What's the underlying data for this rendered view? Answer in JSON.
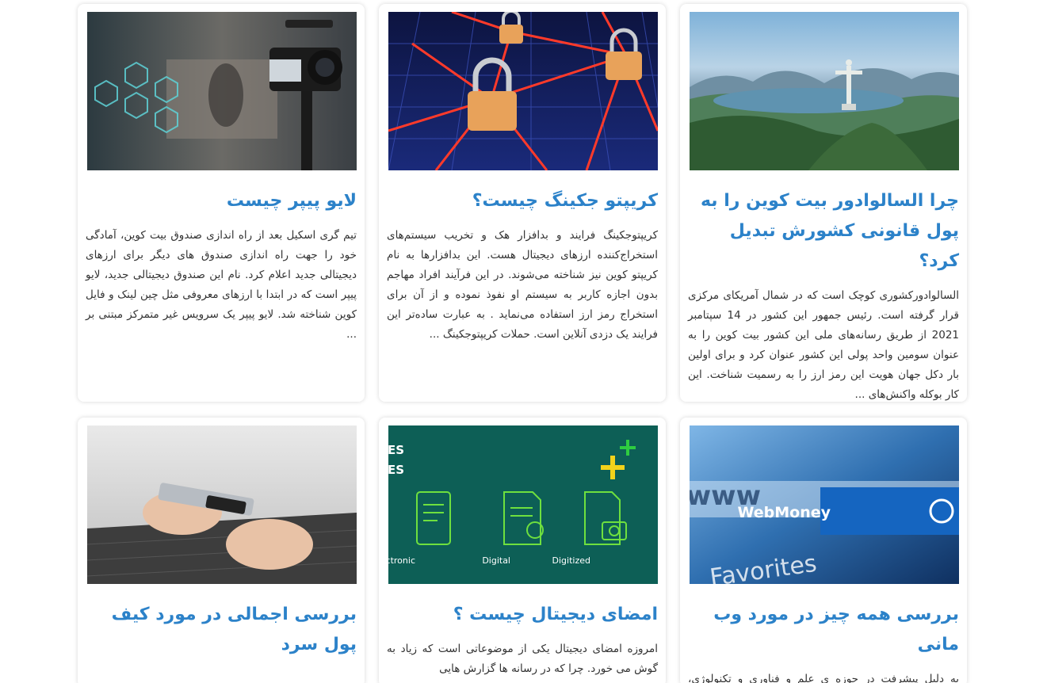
{
  "colors": {
    "title": "#2c82c9",
    "text": "#333333",
    "card_bg": "#ffffff"
  },
  "posts": [
    {
      "title": "چرا السالوادور بیت کوین را به پول قانونی کشورش تبدیل کرد؟",
      "excerpt": "السالوادورکشوری کوچک است که در شمال آمریکای مرکزی قرار گرفته است. رئیس جمهور این کشور در 14 سپتامبر 2021 از طریق رسانه‌های ملی این کشور بیت کوین را به عنوان سومین واحد پولی این کشور عنوان کرد و برای اولین بار دکل جهان هویت این رمز ارز را به رسمیت شناخت. این کار بوکله واکنش‌های ...",
      "image": "rio-christ-redeemer-photo"
    },
    {
      "title": "کریپتو جکینگ چیست؟",
      "excerpt": "کریپتوجکینگ فرایند و بدافزار هک و تخریب سیستم‌های استخراج‌کننده ارزهای دیجیتال هست. این بدافزارها به نام کریپتو کوین نیز شناخته می‌شوند. در این فرآیند افراد مهاجم بدون اجازه کاربر به سیستم او نفوذ نموده و از آن برای استخراج رمز ارز استفاده می‌نماید . به عبارت ساده‌تر این فرایند یک دزدی آنلاین است. حملات کریپتوجکینگ ...",
      "image": "padlock-network-illustration"
    },
    {
      "title": "لایو پیپر چیست",
      "excerpt": "تیم گری اسکیل بعد از راه اندازی صندوق بیت کوین، آمادگی خود را جهت راه اندازی صندوق های دیگر برای ارزهای دیجیتالی جدید اعلام کرد. نام این صندوق دیجیتالی جدید، لایو پیپر است که در ابتدا با ارزهای معروفی مثل چین لینک و فایل کوین شناخته شد. لایو پیپر یک سرویس غیر متمرکز مبتنی بر ...",
      "image": "video-camera-hexagon-icons-photo"
    },
    {
      "title": "بررسی همه چیز در مورد وب مانی",
      "excerpt": "به دلیل پیشرفت در حوزه ی علم و فناوری و تکنولوژی، امروزه اکثر خریدها از طریق اینترنت انجام می شود.",
      "image": "webmoney-browser-photo",
      "image_text": {
        "url": "http://www.",
        "brand": "WebMoney",
        "fav": "Favorites"
      }
    },
    {
      "title": "امضای دیجیتال چیست ؟",
      "excerpt": "امروزه امضای دیجیتال یکی از موضوعاتی است که زیاد به گوش می خورد. چرا که در رسانه ها گزارش هایی",
      "image": "digital-signature-types-infographic",
      "image_text": {
        "heading_line1": "THE DIFFERENCES",
        "heading_line2": "BETWEEN SIGNATURES",
        "labels": [
          "Electronic",
          "Digital",
          "Digitized"
        ]
      }
    },
    {
      "title": "بررسی اجمالی در مورد کیف پول سرد",
      "excerpt": "",
      "image": "hardware-wallet-laptop-photo"
    }
  ]
}
